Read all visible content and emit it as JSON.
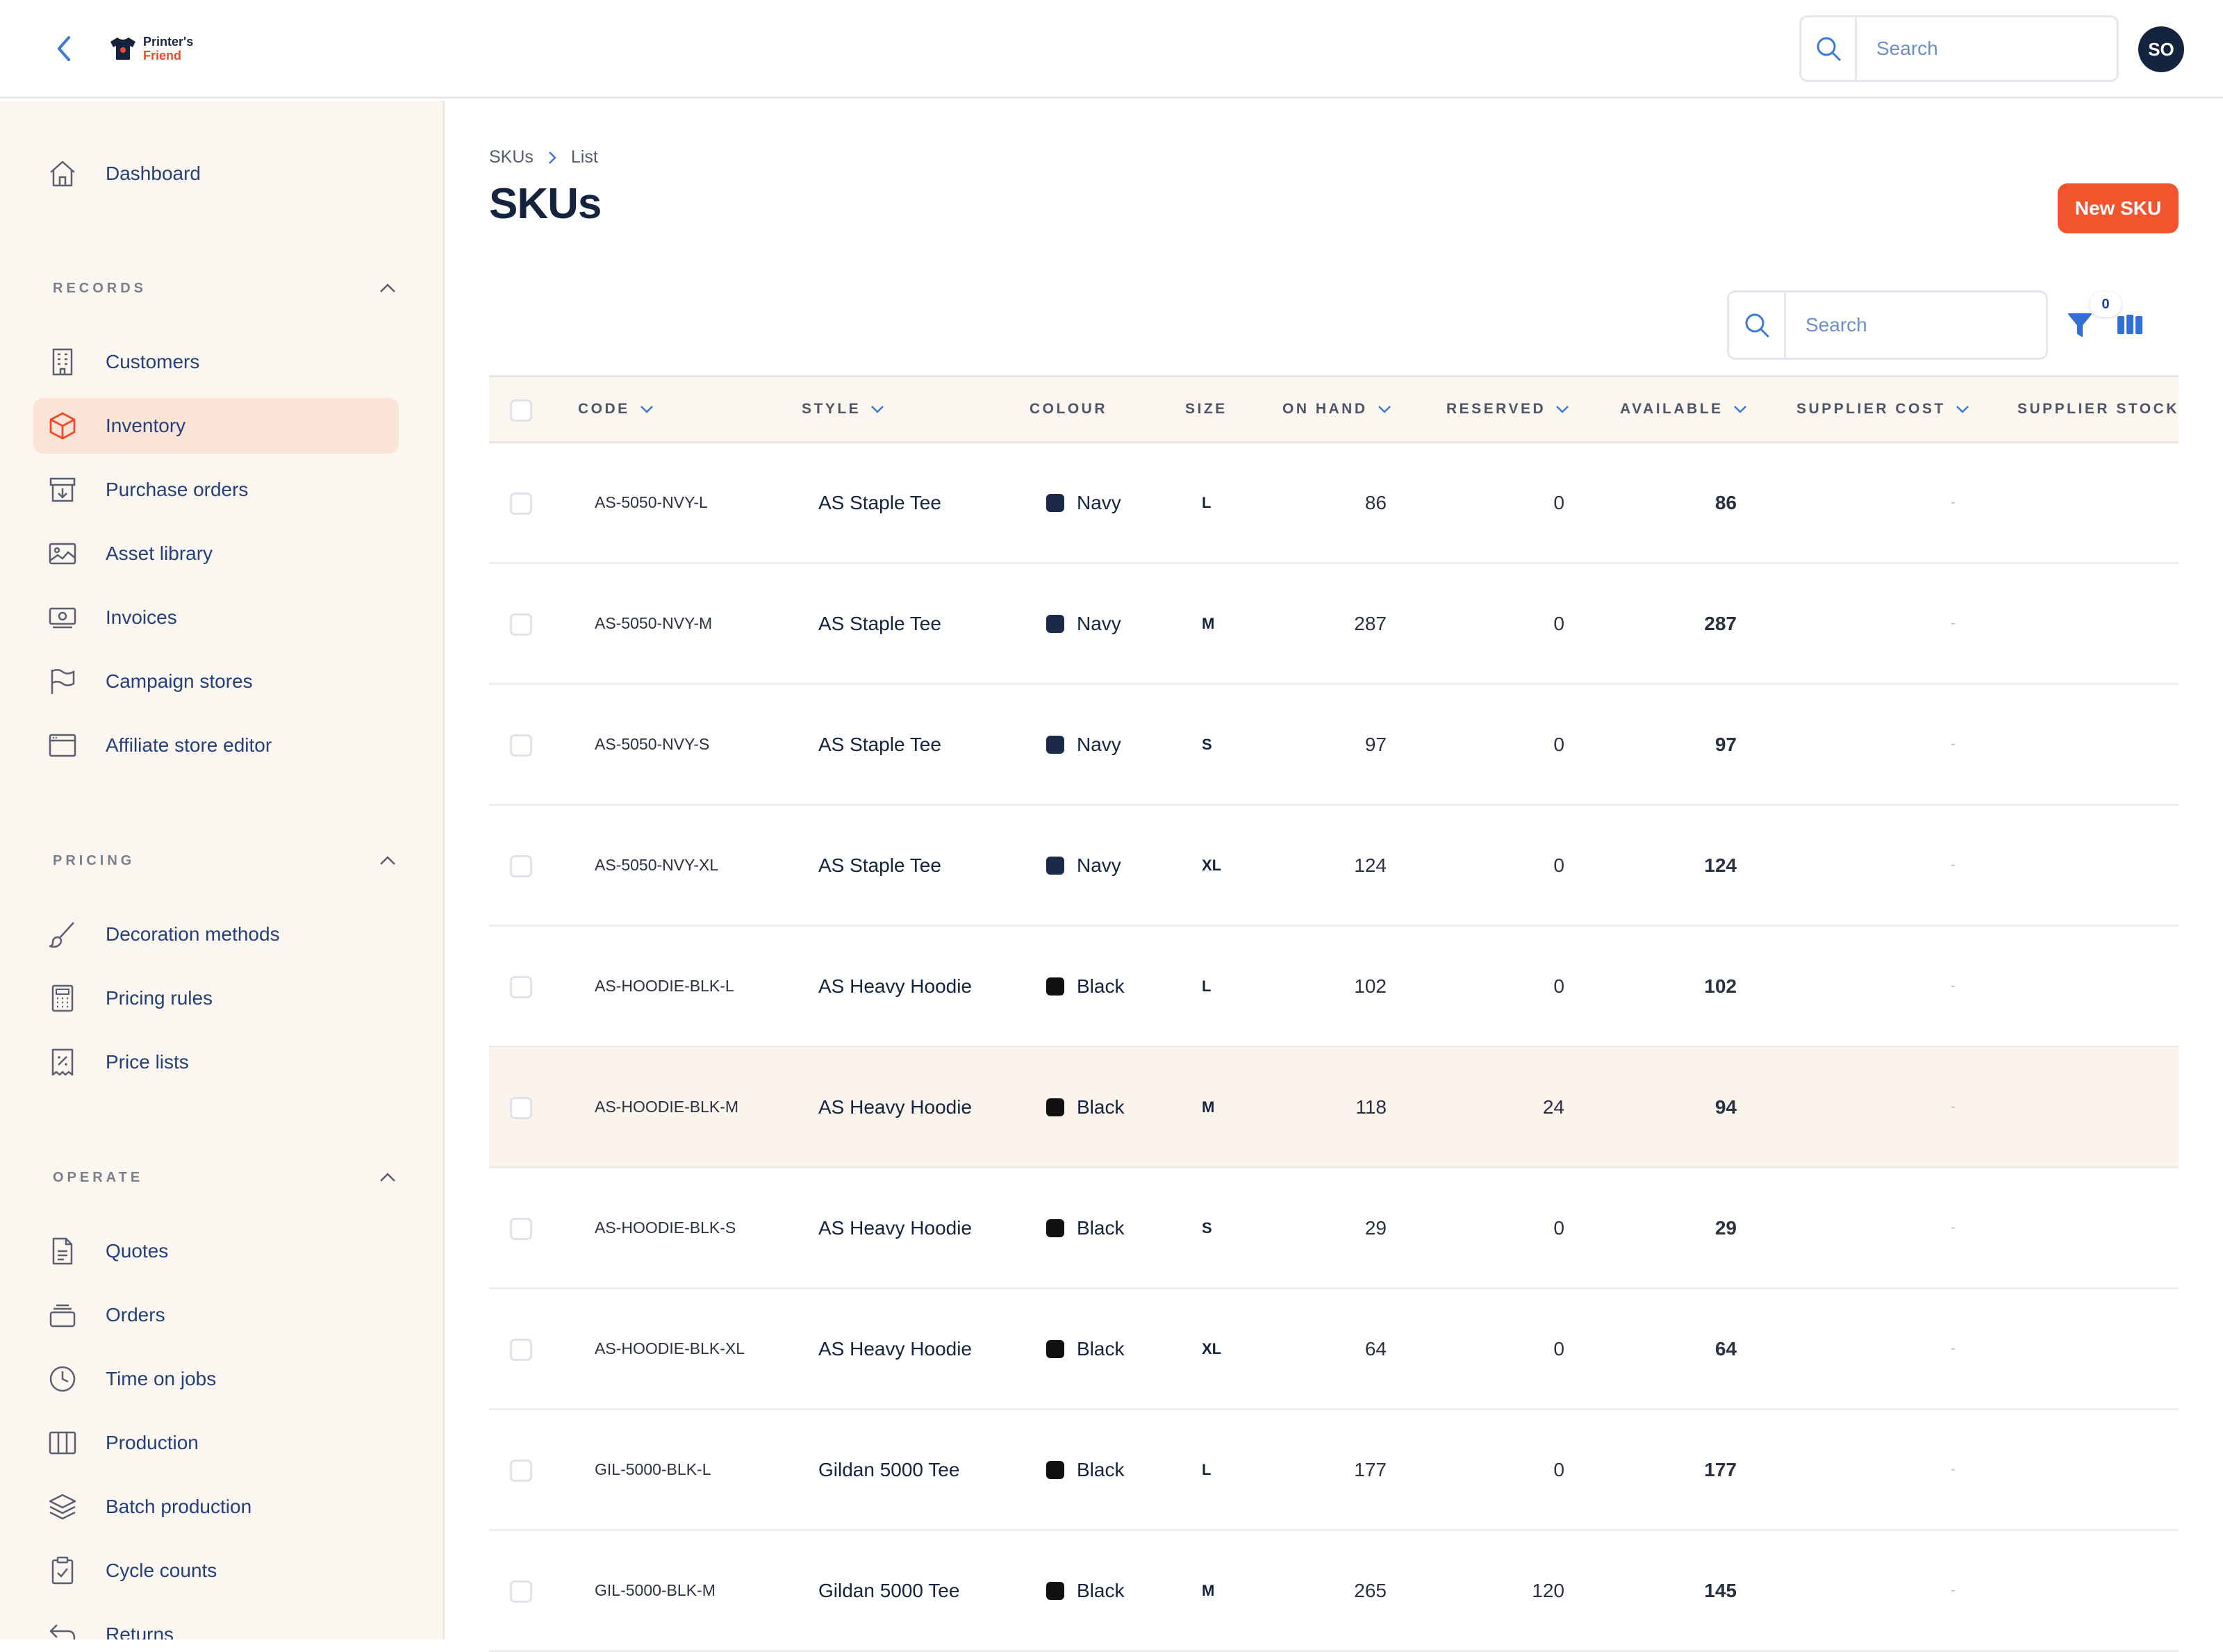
{
  "app": {
    "logo_line1": "Printer's",
    "logo_line2": "Friend",
    "search_placeholder": "Search",
    "avatar_initials": "SO"
  },
  "sidebar": {
    "dashboard": "Dashboard",
    "sections": [
      {
        "title": "RECORDS",
        "items": [
          "Customers",
          "Inventory",
          "Purchase orders",
          "Asset library",
          "Invoices",
          "Campaign stores",
          "Affiliate store editor"
        ]
      },
      {
        "title": "PRICING",
        "items": [
          "Decoration methods",
          "Pricing rules",
          "Price lists"
        ]
      },
      {
        "title": "OPERATE",
        "items": [
          "Quotes",
          "Orders",
          "Time on jobs",
          "Production",
          "Batch production",
          "Cycle counts",
          "Returns"
        ]
      }
    ],
    "active_item": "Inventory"
  },
  "breadcrumb": {
    "root": "SKUs",
    "current": "List"
  },
  "page": {
    "title": "SKUs",
    "new_button": "New SKU"
  },
  "toolbar": {
    "search_placeholder": "Search",
    "filter_count": "0"
  },
  "table": {
    "columns": [
      "CODE",
      "STYLE",
      "COLOUR",
      "SIZE",
      "ON HAND",
      "RESERVED",
      "AVAILABLE",
      "SUPPLIER COST",
      "SUPPLIER STOCK"
    ],
    "rows": [
      {
        "code": "AS-5050-NVY-L",
        "style": "AS Staple Tee",
        "colour": "Navy",
        "size": "L",
        "on_hand": "86",
        "reserved": "0",
        "available": "86",
        "supplier_cost": "-"
      },
      {
        "code": "AS-5050-NVY-M",
        "style": "AS Staple Tee",
        "colour": "Navy",
        "size": "M",
        "on_hand": "287",
        "reserved": "0",
        "available": "287",
        "supplier_cost": "-"
      },
      {
        "code": "AS-5050-NVY-S",
        "style": "AS Staple Tee",
        "colour": "Navy",
        "size": "S",
        "on_hand": "97",
        "reserved": "0",
        "available": "97",
        "supplier_cost": "-"
      },
      {
        "code": "AS-5050-NVY-XL",
        "style": "AS Staple Tee",
        "colour": "Navy",
        "size": "XL",
        "on_hand": "124",
        "reserved": "0",
        "available": "124",
        "supplier_cost": "-"
      },
      {
        "code": "AS-HOODIE-BLK-L",
        "style": "AS Heavy Hoodie",
        "colour": "Black",
        "size": "L",
        "on_hand": "102",
        "reserved": "0",
        "available": "102",
        "supplier_cost": "-"
      },
      {
        "code": "AS-HOODIE-BLK-M",
        "style": "AS Heavy Hoodie",
        "colour": "Black",
        "size": "M",
        "on_hand": "118",
        "reserved": "24",
        "available": "94",
        "supplier_cost": "-"
      },
      {
        "code": "AS-HOODIE-BLK-S",
        "style": "AS Heavy Hoodie",
        "colour": "Black",
        "size": "S",
        "on_hand": "29",
        "reserved": "0",
        "available": "29",
        "supplier_cost": "-"
      },
      {
        "code": "AS-HOODIE-BLK-XL",
        "style": "AS Heavy Hoodie",
        "colour": "Black",
        "size": "XL",
        "on_hand": "64",
        "reserved": "0",
        "available": "64",
        "supplier_cost": "-"
      },
      {
        "code": "GIL-5000-BLK-L",
        "style": "Gildan 5000 Tee",
        "colour": "Black",
        "size": "L",
        "on_hand": "177",
        "reserved": "0",
        "available": "177",
        "supplier_cost": "-"
      },
      {
        "code": "GIL-5000-BLK-M",
        "style": "Gildan 5000 Tee",
        "colour": "Black",
        "size": "M",
        "on_hand": "265",
        "reserved": "120",
        "available": "145",
        "supplier_cost": "-"
      }
    ]
  },
  "colors": {
    "accent": "#f2542d",
    "navy": "#1c2a4a",
    "black": "#111111",
    "sidebar_bg": "#fcf6f0",
    "active_bg": "#fbe3d6"
  }
}
